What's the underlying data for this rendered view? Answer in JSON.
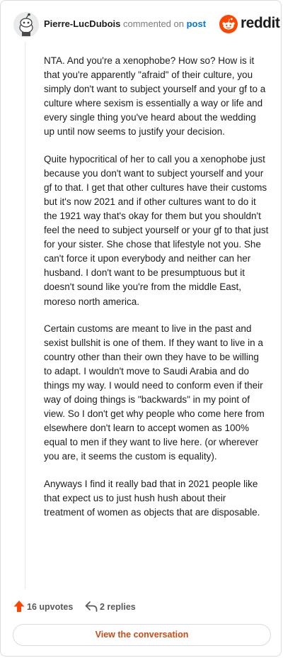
{
  "header": {
    "username": "Pierre-LucDubois",
    "action_text": "commented on",
    "post_link": "post",
    "brand": "reddit"
  },
  "comment": {
    "paragraphs": [
      "NTA. And you're a xenophobe? How so? How is it that you're apparently \"afraid\" of their culture, you simply don't want to subject yourself and your gf to a culture where sexism is essentially a way or life and every single thing you've heard about the wedding up until now seems to justify your decision.",
      "Quite hypocritical of her to call you a xenophobe just because you don't want to subject yourself and your gf to that. I get that other cultures have their customs but it's now 2021 and if other cultures want to do it the 1921 way that's okay for them but you shouldn't feel the need to subject yourself or your gf to that just for your sister. She chose that lifestyle not you. She can't force it upon everybody and neither can her husband. I don't want to be presumptuous but it doesn't sound like you're from the middle East, moreso north america.",
      "Certain customs are meant to live in the past and sexist bullshit is one of them. If they want to live in a country other than their own they have to be willing to adapt. I wouldn't move to Saudi Arabia and do things my way. I would need to conform even if their way of doing things is \"backwards\" in my point of view. So I don't get why people who come here from elsewhere don't learn to accept women as 100% equal to men if they want to live here. (or wherever you are, it seems the custom is equality).",
      "Anyways I find it really bad that in 2021 people like that expect us to just hush hush about their treatment of women as objects that are disposable."
    ]
  },
  "footer": {
    "upvotes": "16 upvotes",
    "replies": "2 replies",
    "view_button": "View the conversation"
  },
  "colors": {
    "brand_orange": "#ff4500",
    "link_blue": "#0079d3",
    "button_text": "#c74b13"
  },
  "icons": {
    "avatar": "snoo-avatar-icon",
    "brand": "reddit-snoo-icon",
    "upvote": "upvote-arrow-icon",
    "reply": "reply-arrow-icon"
  }
}
